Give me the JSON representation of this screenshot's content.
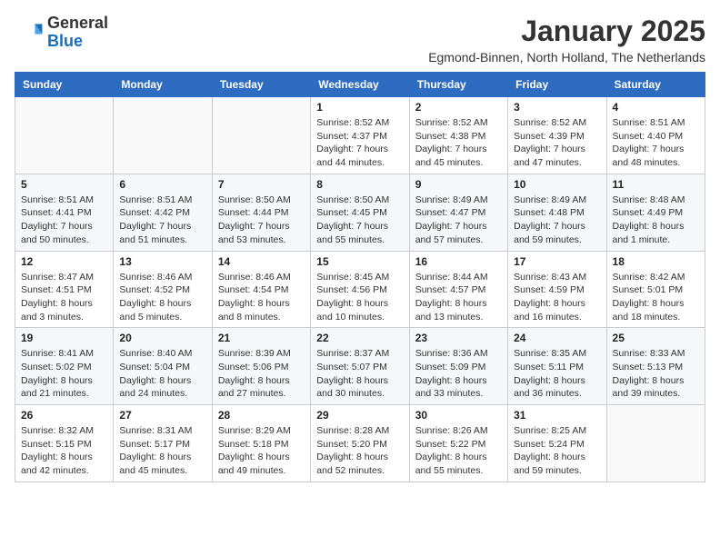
{
  "header": {
    "logo_general": "General",
    "logo_blue": "Blue",
    "month_title": "January 2025",
    "subtitle": "Egmond-Binnen, North Holland, The Netherlands"
  },
  "days_of_week": [
    "Sunday",
    "Monday",
    "Tuesday",
    "Wednesday",
    "Thursday",
    "Friday",
    "Saturday"
  ],
  "weeks": [
    [
      {
        "day": "",
        "info": ""
      },
      {
        "day": "",
        "info": ""
      },
      {
        "day": "",
        "info": ""
      },
      {
        "day": "1",
        "info": "Sunrise: 8:52 AM\nSunset: 4:37 PM\nDaylight: 7 hours and 44 minutes."
      },
      {
        "day": "2",
        "info": "Sunrise: 8:52 AM\nSunset: 4:38 PM\nDaylight: 7 hours and 45 minutes."
      },
      {
        "day": "3",
        "info": "Sunrise: 8:52 AM\nSunset: 4:39 PM\nDaylight: 7 hours and 47 minutes."
      },
      {
        "day": "4",
        "info": "Sunrise: 8:51 AM\nSunset: 4:40 PM\nDaylight: 7 hours and 48 minutes."
      }
    ],
    [
      {
        "day": "5",
        "info": "Sunrise: 8:51 AM\nSunset: 4:41 PM\nDaylight: 7 hours and 50 minutes."
      },
      {
        "day": "6",
        "info": "Sunrise: 8:51 AM\nSunset: 4:42 PM\nDaylight: 7 hours and 51 minutes."
      },
      {
        "day": "7",
        "info": "Sunrise: 8:50 AM\nSunset: 4:44 PM\nDaylight: 7 hours and 53 minutes."
      },
      {
        "day": "8",
        "info": "Sunrise: 8:50 AM\nSunset: 4:45 PM\nDaylight: 7 hours and 55 minutes."
      },
      {
        "day": "9",
        "info": "Sunrise: 8:49 AM\nSunset: 4:47 PM\nDaylight: 7 hours and 57 minutes."
      },
      {
        "day": "10",
        "info": "Sunrise: 8:49 AM\nSunset: 4:48 PM\nDaylight: 7 hours and 59 minutes."
      },
      {
        "day": "11",
        "info": "Sunrise: 8:48 AM\nSunset: 4:49 PM\nDaylight: 8 hours and 1 minute."
      }
    ],
    [
      {
        "day": "12",
        "info": "Sunrise: 8:47 AM\nSunset: 4:51 PM\nDaylight: 8 hours and 3 minutes."
      },
      {
        "day": "13",
        "info": "Sunrise: 8:46 AM\nSunset: 4:52 PM\nDaylight: 8 hours and 5 minutes."
      },
      {
        "day": "14",
        "info": "Sunrise: 8:46 AM\nSunset: 4:54 PM\nDaylight: 8 hours and 8 minutes."
      },
      {
        "day": "15",
        "info": "Sunrise: 8:45 AM\nSunset: 4:56 PM\nDaylight: 8 hours and 10 minutes."
      },
      {
        "day": "16",
        "info": "Sunrise: 8:44 AM\nSunset: 4:57 PM\nDaylight: 8 hours and 13 minutes."
      },
      {
        "day": "17",
        "info": "Sunrise: 8:43 AM\nSunset: 4:59 PM\nDaylight: 8 hours and 16 minutes."
      },
      {
        "day": "18",
        "info": "Sunrise: 8:42 AM\nSunset: 5:01 PM\nDaylight: 8 hours and 18 minutes."
      }
    ],
    [
      {
        "day": "19",
        "info": "Sunrise: 8:41 AM\nSunset: 5:02 PM\nDaylight: 8 hours and 21 minutes."
      },
      {
        "day": "20",
        "info": "Sunrise: 8:40 AM\nSunset: 5:04 PM\nDaylight: 8 hours and 24 minutes."
      },
      {
        "day": "21",
        "info": "Sunrise: 8:39 AM\nSunset: 5:06 PM\nDaylight: 8 hours and 27 minutes."
      },
      {
        "day": "22",
        "info": "Sunrise: 8:37 AM\nSunset: 5:07 PM\nDaylight: 8 hours and 30 minutes."
      },
      {
        "day": "23",
        "info": "Sunrise: 8:36 AM\nSunset: 5:09 PM\nDaylight: 8 hours and 33 minutes."
      },
      {
        "day": "24",
        "info": "Sunrise: 8:35 AM\nSunset: 5:11 PM\nDaylight: 8 hours and 36 minutes."
      },
      {
        "day": "25",
        "info": "Sunrise: 8:33 AM\nSunset: 5:13 PM\nDaylight: 8 hours and 39 minutes."
      }
    ],
    [
      {
        "day": "26",
        "info": "Sunrise: 8:32 AM\nSunset: 5:15 PM\nDaylight: 8 hours and 42 minutes."
      },
      {
        "day": "27",
        "info": "Sunrise: 8:31 AM\nSunset: 5:17 PM\nDaylight: 8 hours and 45 minutes."
      },
      {
        "day": "28",
        "info": "Sunrise: 8:29 AM\nSunset: 5:18 PM\nDaylight: 8 hours and 49 minutes."
      },
      {
        "day": "29",
        "info": "Sunrise: 8:28 AM\nSunset: 5:20 PM\nDaylight: 8 hours and 52 minutes."
      },
      {
        "day": "30",
        "info": "Sunrise: 8:26 AM\nSunset: 5:22 PM\nDaylight: 8 hours and 55 minutes."
      },
      {
        "day": "31",
        "info": "Sunrise: 8:25 AM\nSunset: 5:24 PM\nDaylight: 8 hours and 59 minutes."
      },
      {
        "day": "",
        "info": ""
      }
    ]
  ]
}
